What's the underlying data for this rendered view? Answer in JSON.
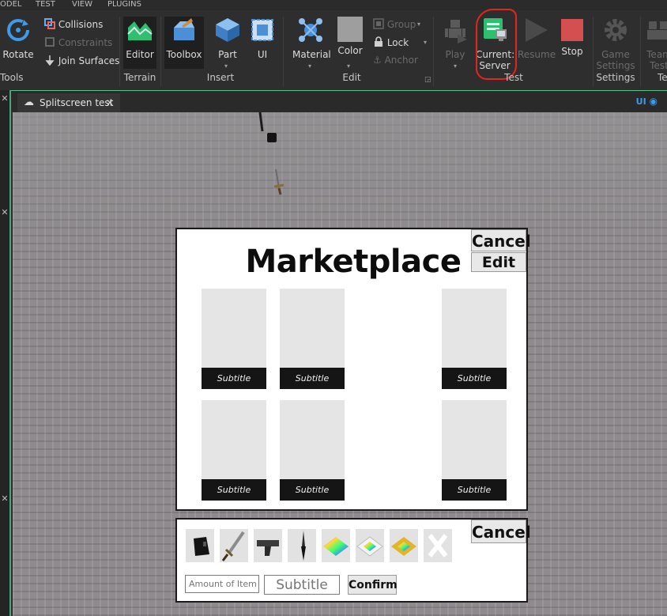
{
  "menu": [
    "ODEL",
    "TEST",
    "VIEW",
    "PLUGINS"
  ],
  "ribbon": {
    "rotate": "Rotate",
    "tools_group": "Tools",
    "collisions": "Collisions",
    "constraints": "Constraints",
    "join_surfaces": "Join Surfaces",
    "editor": "Editor",
    "terrain_group": "Terrain",
    "toolbox": "Toolbox",
    "part": "Part",
    "ui": "UI",
    "insert_group": "Insert",
    "material": "Material",
    "color": "Color",
    "group": "Group",
    "lock": "Lock",
    "anchor": "Anchor",
    "edit_group": "Edit",
    "play": "Play",
    "current_server_line1": "Current:",
    "current_server_line2": "Server",
    "resume": "Resume",
    "stop": "Stop",
    "test_group": "Test",
    "game_settings_line1": "Game",
    "game_settings_line2": "Settings",
    "settings_group": "Settings",
    "team_test_line1": "Team",
    "team_test_line2": "Test",
    "team_group": "Te"
  },
  "tabbar": {
    "tab_label": "Splitscreen test",
    "ui_toggle": "UI"
  },
  "marketplace": {
    "title": "Marketplace",
    "cancel": "Cancel",
    "edit": "Edit",
    "cards": [
      "Subtitle",
      "Subtitle",
      "Subtitle",
      "Subtitle",
      "Subtitle",
      "Subtitle"
    ]
  },
  "inventory": {
    "cancel": "Cancel",
    "amount_placeholder": "Amount of Item",
    "subtitle_placeholder": "Subtitle",
    "confirm": "Confirm",
    "items": [
      "black-box-icon",
      "sword-icon",
      "pistol-icon",
      "knife-icon",
      "rainbow-tile-icon",
      "rainbow-tile-white-icon",
      "rainbow-tile-gold-icon",
      "close-x-icon"
    ]
  },
  "colors": {
    "accent_green": "#52c48a",
    "annotation_red": "#e0261f",
    "stop_red": "#d45050"
  }
}
